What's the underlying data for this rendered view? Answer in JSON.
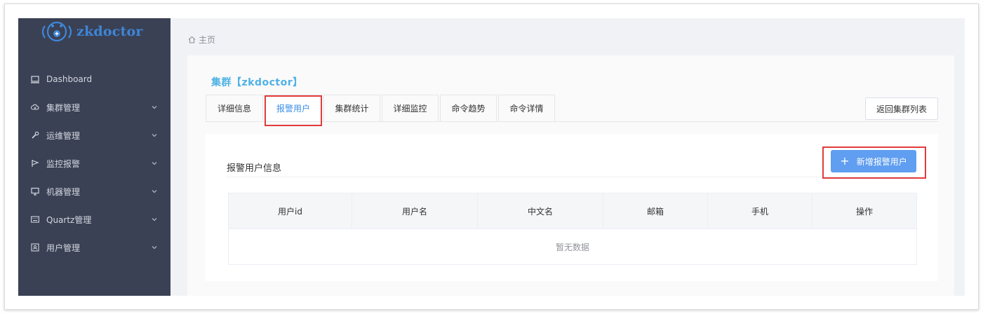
{
  "app": {
    "logo_text": "zkdoctor"
  },
  "sidebar": {
    "items": [
      {
        "label": "Dashboard",
        "icon": "monitor-icon",
        "has_submenu": false
      },
      {
        "label": "集群管理",
        "icon": "cloud-icon",
        "has_submenu": true
      },
      {
        "label": "运维管理",
        "icon": "wrench-icon",
        "has_submenu": true
      },
      {
        "label": "监控报警",
        "icon": "flag-icon",
        "has_submenu": true
      },
      {
        "label": "机器管理",
        "icon": "desktop-icon",
        "has_submenu": true
      },
      {
        "label": "Quartz管理",
        "icon": "keyboard-icon",
        "has_submenu": true
      },
      {
        "label": "用户管理",
        "icon": "user-card-icon",
        "has_submenu": true
      }
    ]
  },
  "breadcrumb": {
    "home_label": "主页"
  },
  "cluster": {
    "title": "集群【zkdoctor】"
  },
  "tabs": [
    {
      "label": "详细信息",
      "active": false
    },
    {
      "label": "报警用户",
      "active": true
    },
    {
      "label": "集群统计",
      "active": false
    },
    {
      "label": "详细监控",
      "active": false
    },
    {
      "label": "命令趋势",
      "active": false
    },
    {
      "label": "命令详情",
      "active": false
    }
  ],
  "actions": {
    "back_label": "返回集群列表",
    "add_label": "新增报警用户"
  },
  "panel": {
    "title": "报警用户信息"
  },
  "table": {
    "columns": [
      "用户id",
      "用户名",
      "中文名",
      "邮箱",
      "手机",
      "操作"
    ],
    "empty_text": "暂无数据"
  },
  "colors": {
    "sidebar_bg": "#3a4154",
    "accent": "#5f9ef0",
    "title": "#4fb2e5",
    "highlight": "#e23b3b"
  }
}
